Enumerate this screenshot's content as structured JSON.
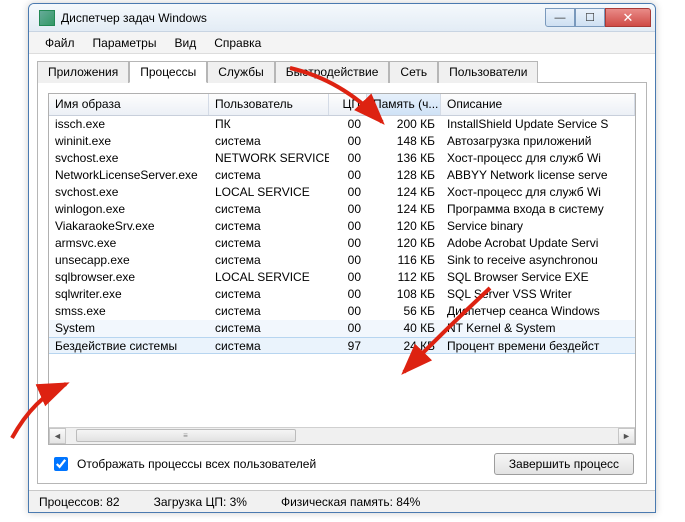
{
  "window": {
    "title": "Диспетчер задач Windows"
  },
  "menu": {
    "file": "Файл",
    "options": "Параметры",
    "view": "Вид",
    "help": "Справка"
  },
  "tabs": {
    "apps": "Приложения",
    "processes": "Процессы",
    "services": "Службы",
    "performance": "Быстродействие",
    "network": "Сеть",
    "users": "Пользователи"
  },
  "columns": {
    "image": "Имя образа",
    "user": "Пользователь",
    "cpu": "ЦП",
    "memory": "Память (ч...",
    "desc": "Описание"
  },
  "rows": [
    {
      "img": "issch.exe",
      "user": "ПК",
      "cpu": "00",
      "mem": "200 КБ",
      "desc": "InstallShield Update Service S"
    },
    {
      "img": "wininit.exe",
      "user": "система",
      "cpu": "00",
      "mem": "148 КБ",
      "desc": "Автозагрузка приложений"
    },
    {
      "img": "svchost.exe",
      "user": "NETWORK SERVICE",
      "cpu": "00",
      "mem": "136 КБ",
      "desc": "Хост-процесс для служб Wi"
    },
    {
      "img": "NetworkLicenseServer.exe",
      "user": "система",
      "cpu": "00",
      "mem": "128 КБ",
      "desc": "ABBYY Network license serve"
    },
    {
      "img": "svchost.exe",
      "user": "LOCAL SERVICE",
      "cpu": "00",
      "mem": "124 КБ",
      "desc": "Хост-процесс для служб Wi"
    },
    {
      "img": "winlogon.exe",
      "user": "система",
      "cpu": "00",
      "mem": "124 КБ",
      "desc": "Программа входа в систему"
    },
    {
      "img": "ViakaraokeSrv.exe",
      "user": "система",
      "cpu": "00",
      "mem": "120 КБ",
      "desc": "Service binary"
    },
    {
      "img": "armsvc.exe",
      "user": "система",
      "cpu": "00",
      "mem": "120 КБ",
      "desc": "Adobe Acrobat Update Servi"
    },
    {
      "img": "unsecapp.exe",
      "user": "система",
      "cpu": "00",
      "mem": "116 КБ",
      "desc": "Sink to receive asynchronou"
    },
    {
      "img": "sqlbrowser.exe",
      "user": "LOCAL SERVICE",
      "cpu": "00",
      "mem": "112 КБ",
      "desc": "SQL Browser Service EXE"
    },
    {
      "img": "sqlwriter.exe",
      "user": "система",
      "cpu": "00",
      "mem": "108 КБ",
      "desc": "SQL Server VSS Writer"
    },
    {
      "img": "smss.exe",
      "user": "система",
      "cpu": "00",
      "mem": "56 КБ",
      "desc": "Диспетчер сеанса  Windows"
    },
    {
      "img": "System",
      "user": "система",
      "cpu": "00",
      "mem": "40 КБ",
      "desc": "NT Kernel & System"
    },
    {
      "img": "Бездействие системы",
      "user": "система",
      "cpu": "97",
      "mem": "24 КБ",
      "desc": "Процент времени бездейст"
    }
  ],
  "footer": {
    "showall": "Отображать процессы всех пользователей",
    "endproc": "Завершить процесс"
  },
  "status": {
    "processes": "Процессов: 82",
    "cpu": "Загрузка ЦП: 3%",
    "mem": "Физическая память: 84%"
  }
}
